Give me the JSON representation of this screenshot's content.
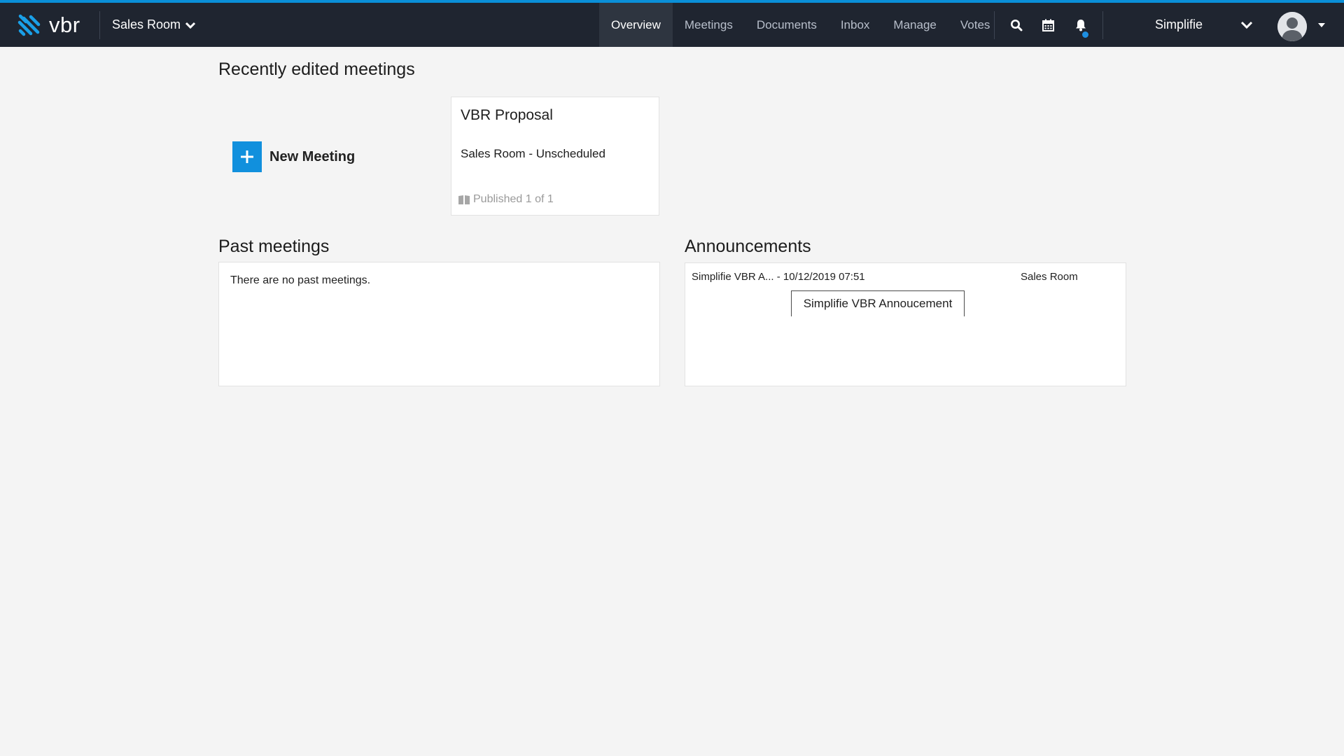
{
  "app": {
    "logo_text": "vbr",
    "room_switcher": "Sales Room"
  },
  "nav": {
    "items": [
      {
        "label": "Overview",
        "active": true
      },
      {
        "label": "Meetings"
      },
      {
        "label": "Documents"
      },
      {
        "label": "Inbox"
      },
      {
        "label": "Manage"
      },
      {
        "label": "Votes"
      }
    ]
  },
  "toolbar": {
    "icons": [
      "search-icon",
      "calendar-icon",
      "bell-icon"
    ],
    "account_name": "Simplifie"
  },
  "recent": {
    "title": "Recently edited meetings",
    "new_meeting_label": "New Meeting",
    "meetings": [
      {
        "title": "VBR Proposal",
        "subtitle": "Sales Room - Unscheduled",
        "status": "Published 1 of 1"
      }
    ]
  },
  "past": {
    "title": "Past meetings",
    "empty_text": "There are no past meetings."
  },
  "announcements": {
    "title": "Announcements",
    "items": [
      {
        "meta": "Simplifie VBR A... - 10/12/2019 07:51",
        "room": "Sales Room"
      }
    ],
    "tooltip": "Simplifie VBR Annoucement"
  },
  "colors": {
    "topbar": "#1f2530",
    "accent": "#0a8fd8",
    "active_nav": "#2e3540",
    "background": "#f4f4f4"
  }
}
